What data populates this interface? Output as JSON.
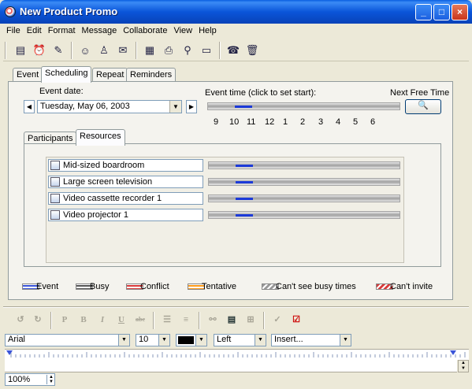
{
  "window": {
    "title": "New Product Promo",
    "minimize": "_",
    "maximize": "□",
    "close": "×"
  },
  "menu": [
    "File",
    "Edit",
    "Format",
    "Message",
    "Collaborate",
    "View",
    "Help"
  ],
  "tabs": {
    "event": "Event",
    "scheduling": "Scheduling",
    "repeat": "Repeat",
    "reminders": "Reminders"
  },
  "scheduling": {
    "event_date_label": "Event date:",
    "event_date_value": "Tuesday, May 06, 2003",
    "event_time_label": "Event time (click to set start):",
    "next_free_time_label": "Next Free Time",
    "hours": [
      "9",
      "10",
      "11",
      "12",
      "1",
      "2",
      "3",
      "4",
      "5",
      "6"
    ]
  },
  "subtabs": {
    "participants": "Participants",
    "resources": "Resources"
  },
  "resources": [
    "Mid-sized boardroom",
    "Large screen television",
    "Video cassette recorder 1",
    "Video projector 1"
  ],
  "legend": [
    {
      "label": "Event",
      "color": "#3a54d8"
    },
    {
      "label": "Busy",
      "color": "#555555"
    },
    {
      "label": "Conflict",
      "color": "#d83a3a"
    },
    {
      "label": "Tentative",
      "color": "#ff9a1a"
    },
    {
      "label": "Can't see busy times",
      "color": "#999999"
    },
    {
      "label": "Can't invite",
      "color": "#d83a3a"
    }
  ],
  "format": {
    "font": "Arial",
    "size": "10",
    "color": "#000000",
    "align": "Left",
    "insert": "Insert...",
    "zoom": "100%"
  }
}
